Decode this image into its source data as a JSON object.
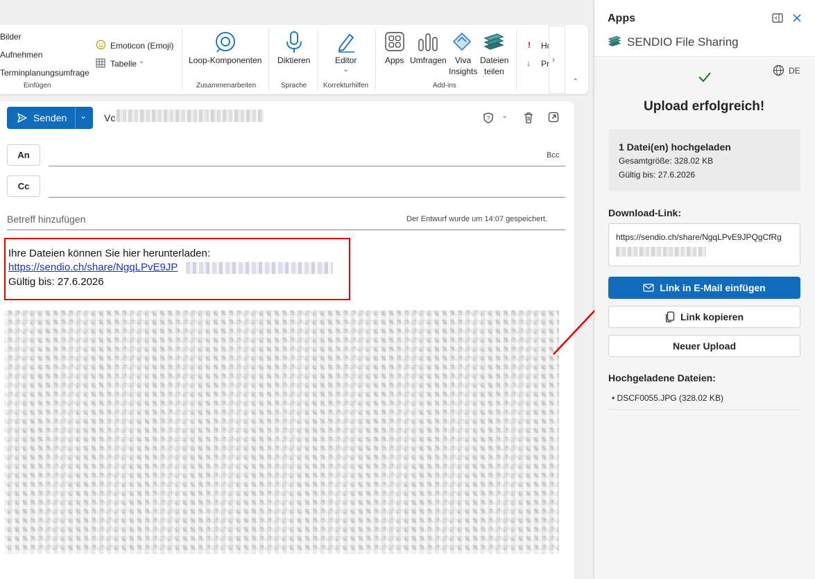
{
  "ribbon": {
    "insert": {
      "pictures": "Bilder",
      "record": "Aufnehmen",
      "schedule_poll": "Terminplanungsumfrage",
      "emoji": "Emoticon (Emoji)",
      "table": "Tabelle",
      "caption": "Einfügen"
    },
    "collab": {
      "loop": "Loop-Komponenten",
      "caption": "Zusammenarbeiten"
    },
    "voice": {
      "dictate": "Diktieren",
      "caption": "Sprache"
    },
    "proofing": {
      "editor": "Editor",
      "caption": "Korrekturhilfen"
    },
    "addins": {
      "apps": "Apps",
      "polls": "Umfragen",
      "viva_line1": "Viva",
      "viva_line2": "Insights",
      "share_line1": "Dateien",
      "share_line2": "teilen",
      "caption": "Add-ins"
    },
    "cut1": "Ho",
    "cut2": "Pr"
  },
  "compose": {
    "send_label": "Senden",
    "from_prefix": "Vc",
    "to_label": "An",
    "cc_label": "Cc",
    "bcc_label": "Bcc",
    "subject_placeholder": "Betreff hinzufügen",
    "draft_status": "Der Entwurf wurde um 14:07 gespeichert.",
    "body": {
      "line1": "Ihre Dateien können Sie hier herunterladen:",
      "link": "https://sendio.ch/share/NgqLPvE9JP",
      "line3": "Gültig bis: 27.6.2026"
    }
  },
  "pane": {
    "title": "Apps",
    "app_name": "SENDIO File Sharing",
    "lang": "DE",
    "success_title": "Upload erfolgreich!",
    "summary": {
      "count": "1 Datei(en) hochgeladen",
      "size": "Gesamtgröße: 328.02 KB",
      "valid": "Gültig bis: 27.6.2026"
    },
    "download_label": "Download-Link:",
    "download_link": "https://sendio.ch/share/NgqLPvE9JPQgCfRg",
    "insert_button": "Link in E-Mail einfügen",
    "copy_button": "Link kopieren",
    "new_upload_button": "Neuer Upload",
    "uploaded_label": "Hochgeladene Dateien:",
    "files": [
      "• DSCF0055.JPG (328.02 KB)"
    ]
  },
  "colors": {
    "accent": "#0f6cbd",
    "annotation": "#e00000",
    "success": "#107c10"
  }
}
